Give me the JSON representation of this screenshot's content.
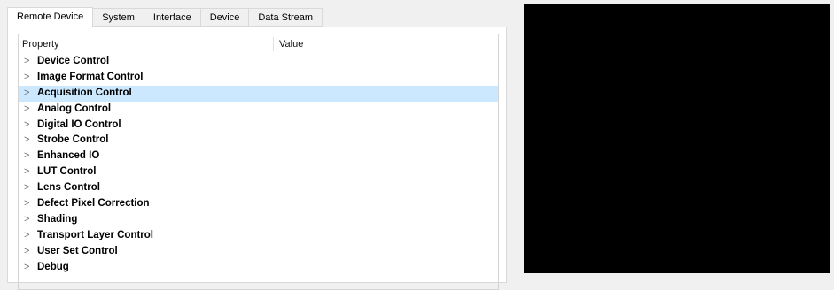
{
  "tabs": [
    {
      "label": "Remote Device",
      "active": true
    },
    {
      "label": "System",
      "active": false
    },
    {
      "label": "Interface",
      "active": false
    },
    {
      "label": "Device",
      "active": false
    },
    {
      "label": "Data Stream",
      "active": false
    }
  ],
  "grid": {
    "header": {
      "property": "Property",
      "value": "Value"
    },
    "expander_glyph": ">",
    "rows": [
      {
        "label": "Device Control"
      },
      {
        "label": "Image Format Control"
      },
      {
        "label": "Acquisition Control",
        "selected": true
      },
      {
        "label": "Analog Control"
      },
      {
        "label": "Digital IO Control"
      },
      {
        "label": "Strobe Control"
      },
      {
        "label": "Enhanced IO"
      },
      {
        "label": "LUT Control"
      },
      {
        "label": "Lens Control"
      },
      {
        "label": "Defect Pixel Correction"
      },
      {
        "label": "Shading"
      },
      {
        "label": "Transport Layer Control"
      },
      {
        "label": "User Set Control"
      },
      {
        "label": "Debug"
      }
    ]
  },
  "colors": {
    "selected_row": "#cce8ff",
    "video_background": "#000000"
  }
}
